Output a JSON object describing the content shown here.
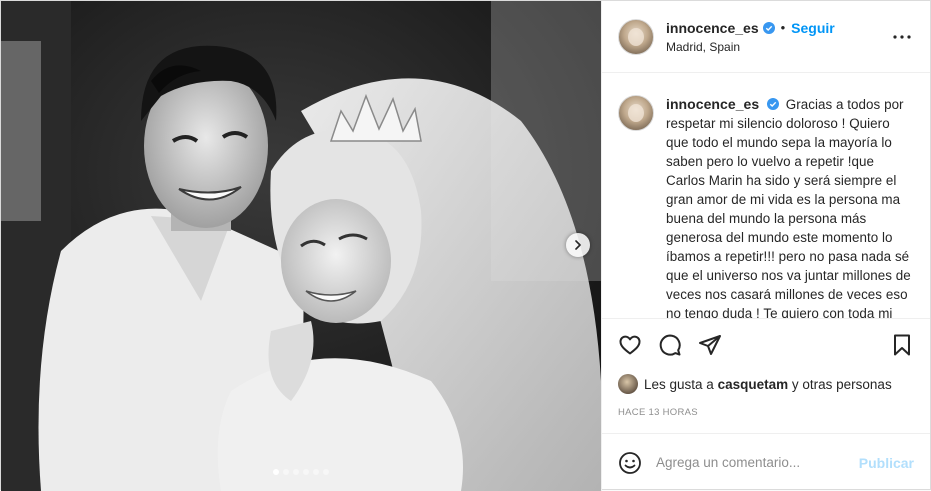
{
  "post": {
    "username": "innocence_es",
    "verified": true,
    "follow_label": "Seguir",
    "separator": "•",
    "location": "Madrid, Spain",
    "more_icon": "more-horizontal-icon"
  },
  "media": {
    "image_description_icon": "wedding-photo",
    "next_icon": "chevron-right-icon",
    "carousel_count": 6,
    "carousel_active": 0
  },
  "caption": {
    "username": "innocence_es",
    "text": "Gracias a todos por respetar mi silencio doloroso ! Quiero que todo el mundo sepa la mayoría lo saben pero lo vuelvo a repetir !que Carlos Marin ha sido y será siempre el gran amor de mi vida es la persona ma buena del mundo la persona más generosa del mundo este momento lo íbamos a repetir!!! pero no pasa nada sé que el universo nos va juntar millones de veces nos casará millones de veces eso no tengo duda ! Te quiero con toda mi"
  },
  "actions": {
    "like_icon": "heart-icon",
    "comment_icon": "comment-icon",
    "share_icon": "paper-plane-icon",
    "save_icon": "bookmark-icon"
  },
  "likes": {
    "prefix": "Les gusta a",
    "user": "casquetam",
    "suffix": "y otras personas"
  },
  "timestamp": "HACE 13 HORAS",
  "comment_box": {
    "placeholder": "Agrega un comentario...",
    "publish_label": "Publicar",
    "emoji_icon": "smiley-icon"
  },
  "colors": {
    "accent": "#0095f6",
    "verified": "#3897f0",
    "publish_disabled": "#b2dffc",
    "muted": "#8e8e8e"
  }
}
